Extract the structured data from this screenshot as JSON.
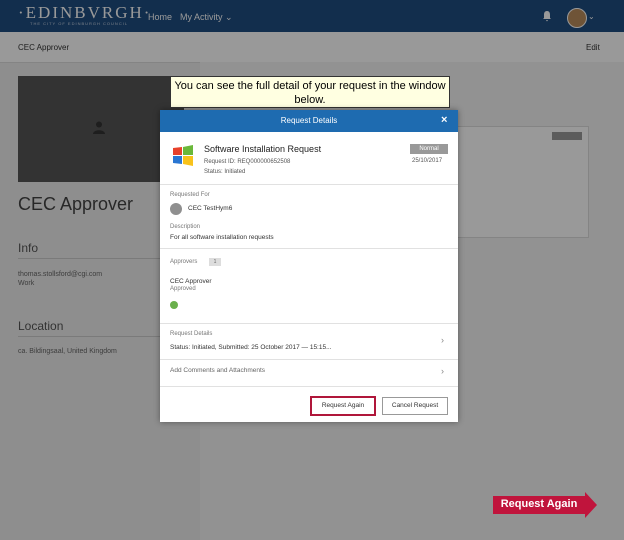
{
  "navbar": {
    "logo": "·EDINBVRGH·",
    "logo_sub": "THE CITY OF EDINBURGH COUNCIL",
    "home": "Home",
    "my_activity": "My Activity",
    "chevron": "⌄"
  },
  "subbar": {
    "title": "CEC Approver",
    "edit": "Edit"
  },
  "profile": {
    "name": "CEC Approver",
    "info_heading": "Info",
    "email": "thomas.stollsford@cgi.com",
    "email_type": "Work",
    "location_heading": "Location",
    "location_text": "ca. Bildingsaal, United Kingdom"
  },
  "callout": {
    "text": "You can see the full detail of your request in the window below."
  },
  "modal": {
    "title": "Request Details",
    "close": "×",
    "request_title": "Software Installation Request",
    "request_id": "Request ID: REQ000000652508",
    "status": "Status: Initiated",
    "priority_badge": "Normal",
    "date": "25/10/2017",
    "requested_for_label": "Requested For",
    "requested_for_value": "CEC TestHym6",
    "description_label": "Description",
    "description_value": "For all software installation requests",
    "approvers_label": "Approvers",
    "approvers_count": "1",
    "approver_name": "CEC Approver",
    "approver_status": "Approved",
    "request_details_label": "Request Details",
    "request_details_value": "Status: Initiated, Submitted: 25 October 2017 — 15:15...",
    "add_comments": "Add Comments and Attachments",
    "chevron_right": "›",
    "request_again_btn": "Request Again",
    "cancel_btn": "Cancel Request"
  },
  "arrow_callout": {
    "text": "Request Again",
    "color": "#c0143c"
  },
  "colors": {
    "nav": "#1e4d80",
    "modal_header": "#1e6bb0",
    "highlight": "#b0163a"
  }
}
